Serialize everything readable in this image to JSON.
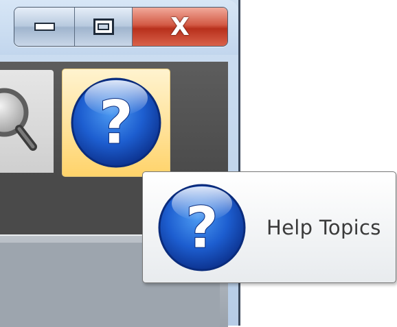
{
  "window": {
    "caption_buttons": {
      "minimize_icon": "minimize-icon",
      "maximize_icon": "maximize-icon",
      "close_glyph": "X"
    }
  },
  "toolbar": {
    "items": [
      {
        "icon": "search-icon",
        "state": "normal"
      },
      {
        "icon": "help-icon",
        "state": "hover"
      }
    ]
  },
  "tooltip": {
    "label": "Help Topics",
    "icon": "help-icon"
  },
  "colors": {
    "help_blue": "#1a5fc6",
    "hover_gold": "#ffd36a",
    "close_red": "#c8422b"
  }
}
